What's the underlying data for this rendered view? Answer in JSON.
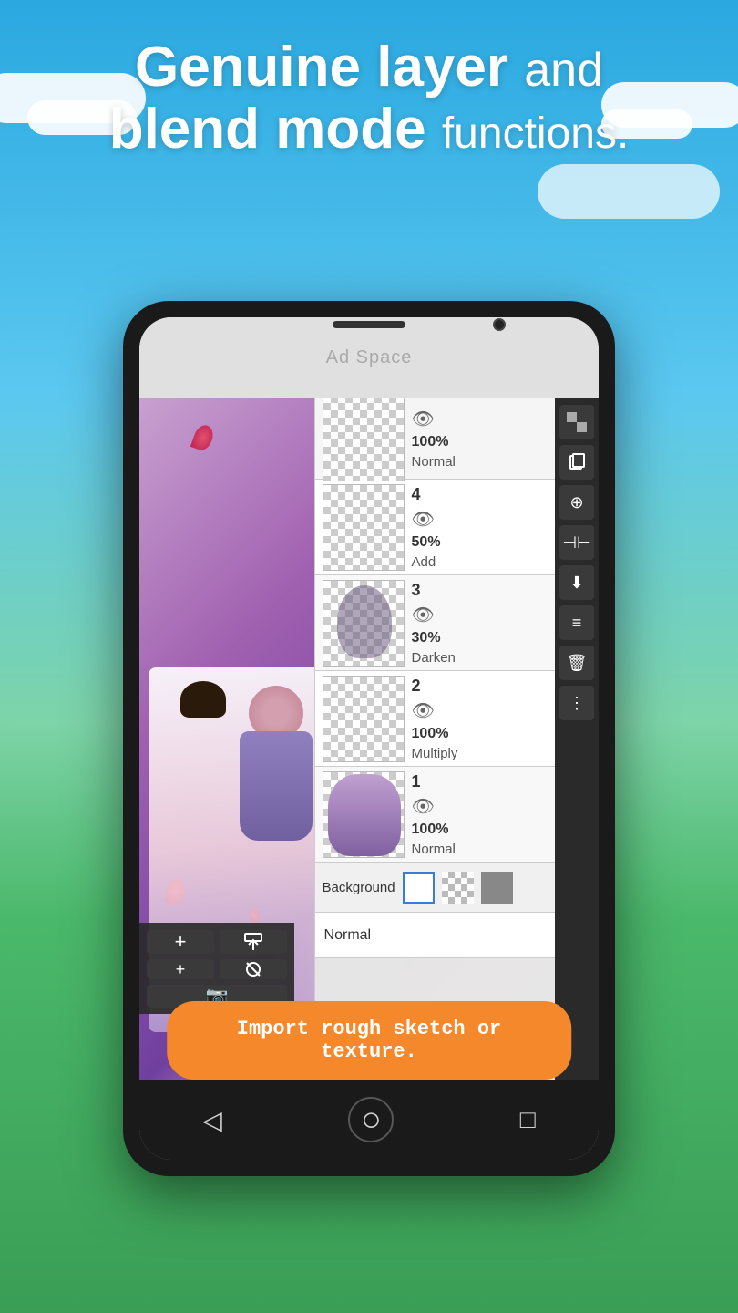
{
  "background": {
    "sky_color": "#2aa8e0",
    "grass_color": "#4ab86a"
  },
  "header": {
    "line1_bold": "Genuine layer",
    "line1_light": "and",
    "line2_bold": "blend mode",
    "line2_light": "functions."
  },
  "ad_space": {
    "label": "Ad Space"
  },
  "layers": [
    {
      "number": "",
      "opacity": "100%",
      "blend": "Normal",
      "has_number": false
    },
    {
      "number": "4",
      "opacity": "50%",
      "blend": "Add",
      "has_number": true
    },
    {
      "number": "3",
      "opacity": "30%",
      "blend": "Darken",
      "has_number": true
    },
    {
      "number": "2",
      "opacity": "100%",
      "blend": "Multiply",
      "has_number": true
    },
    {
      "number": "1",
      "opacity": "100%",
      "blend": "Normal",
      "has_number": true
    }
  ],
  "background_row": {
    "label": "Background"
  },
  "blend_mode_bar": {
    "value": "Normal"
  },
  "orange_banner": {
    "text": "Import rough sketch or texture."
  },
  "nav": {
    "back": "◁",
    "home": "○",
    "recent": "□"
  }
}
